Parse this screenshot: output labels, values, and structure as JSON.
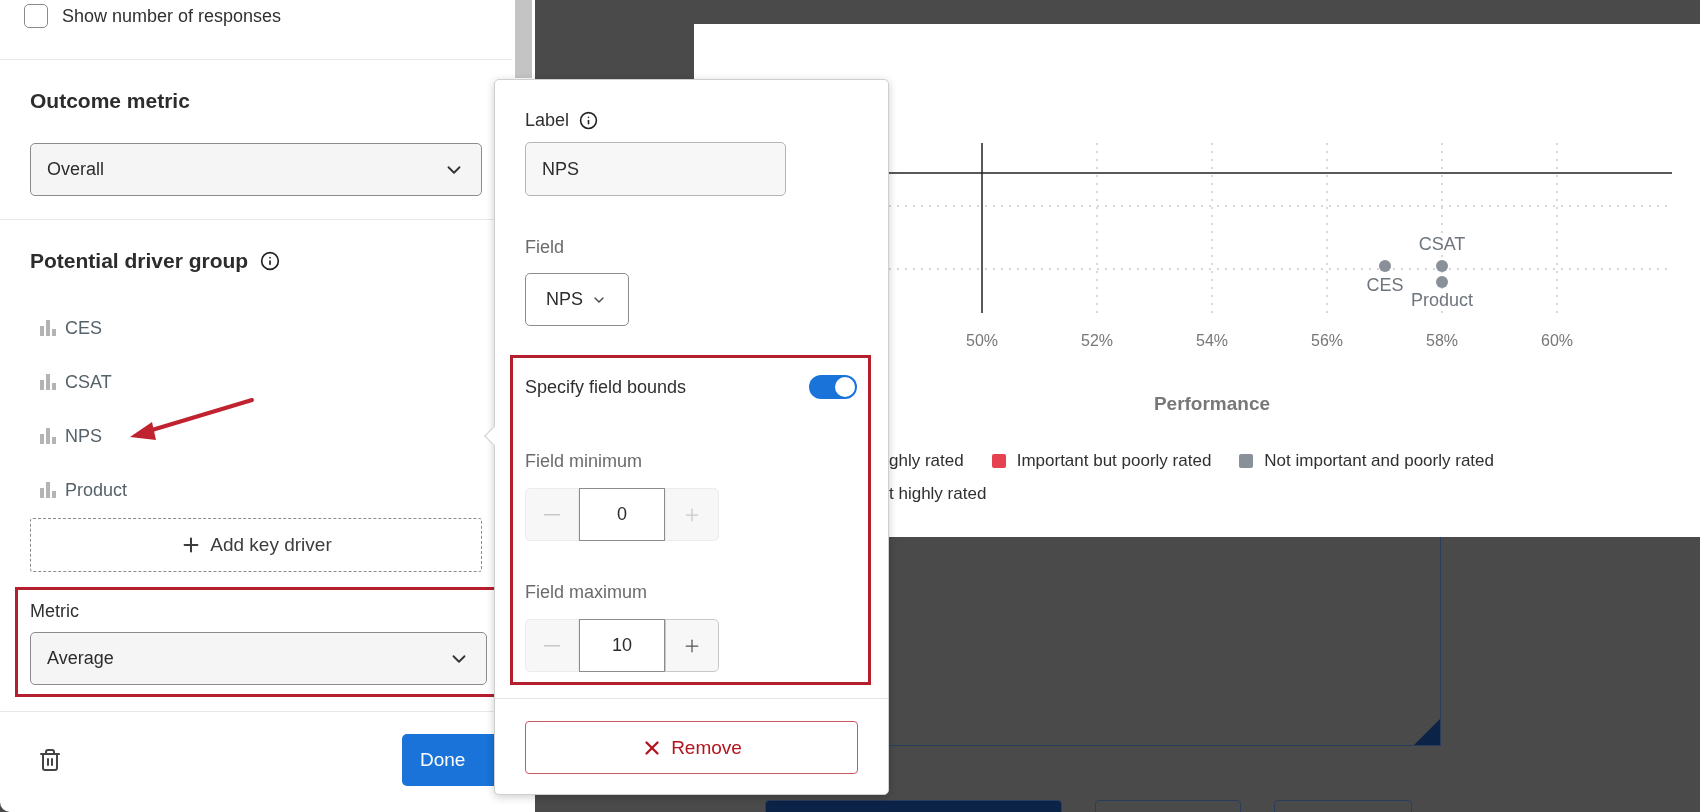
{
  "options_panel": {
    "show_responses": {
      "label": "Show number of responses",
      "checked": false
    },
    "outcome_metric": {
      "title": "Outcome metric",
      "value": "Overall"
    },
    "driver_group": {
      "title": "Potential driver group",
      "drivers": [
        "CES",
        "CSAT",
        "NPS",
        "Product"
      ],
      "add_button": "Add key driver",
      "metric_label": "Metric",
      "metric_value": "Average"
    },
    "done_button": "Done"
  },
  "driver_popover": {
    "label_title": "Label",
    "label_value": "NPS",
    "field_title": "Field",
    "field_value": "NPS",
    "bounds": {
      "title": "Specify field bounds",
      "on": true,
      "minimum": {
        "title": "Field minimum",
        "value": "0",
        "decrement_disabled": true,
        "increment_disabled": true
      },
      "maximum": {
        "title": "Field maximum",
        "value": "10",
        "decrement_disabled": true,
        "increment_disabled": false
      }
    },
    "remove_button": "Remove"
  },
  "chart": {
    "x_ticks": [
      "50%",
      "52%",
      "54%",
      "56%",
      "58%",
      "60%"
    ],
    "x_title": "Performance",
    "points": [
      {
        "label": "CSAT"
      },
      {
        "label": "CES"
      },
      {
        "label": "Product"
      }
    ],
    "legend_rows": [
      {
        "items": [
          {
            "label": "ghly rated"
          },
          {
            "label": "Important but poorly rated",
            "color": "#e5414f"
          },
          {
            "label": "Not important and poorly rated",
            "color": "#8a9099"
          }
        ]
      },
      {
        "items": [
          {
            "label": "t highly rated"
          }
        ]
      }
    ]
  }
}
